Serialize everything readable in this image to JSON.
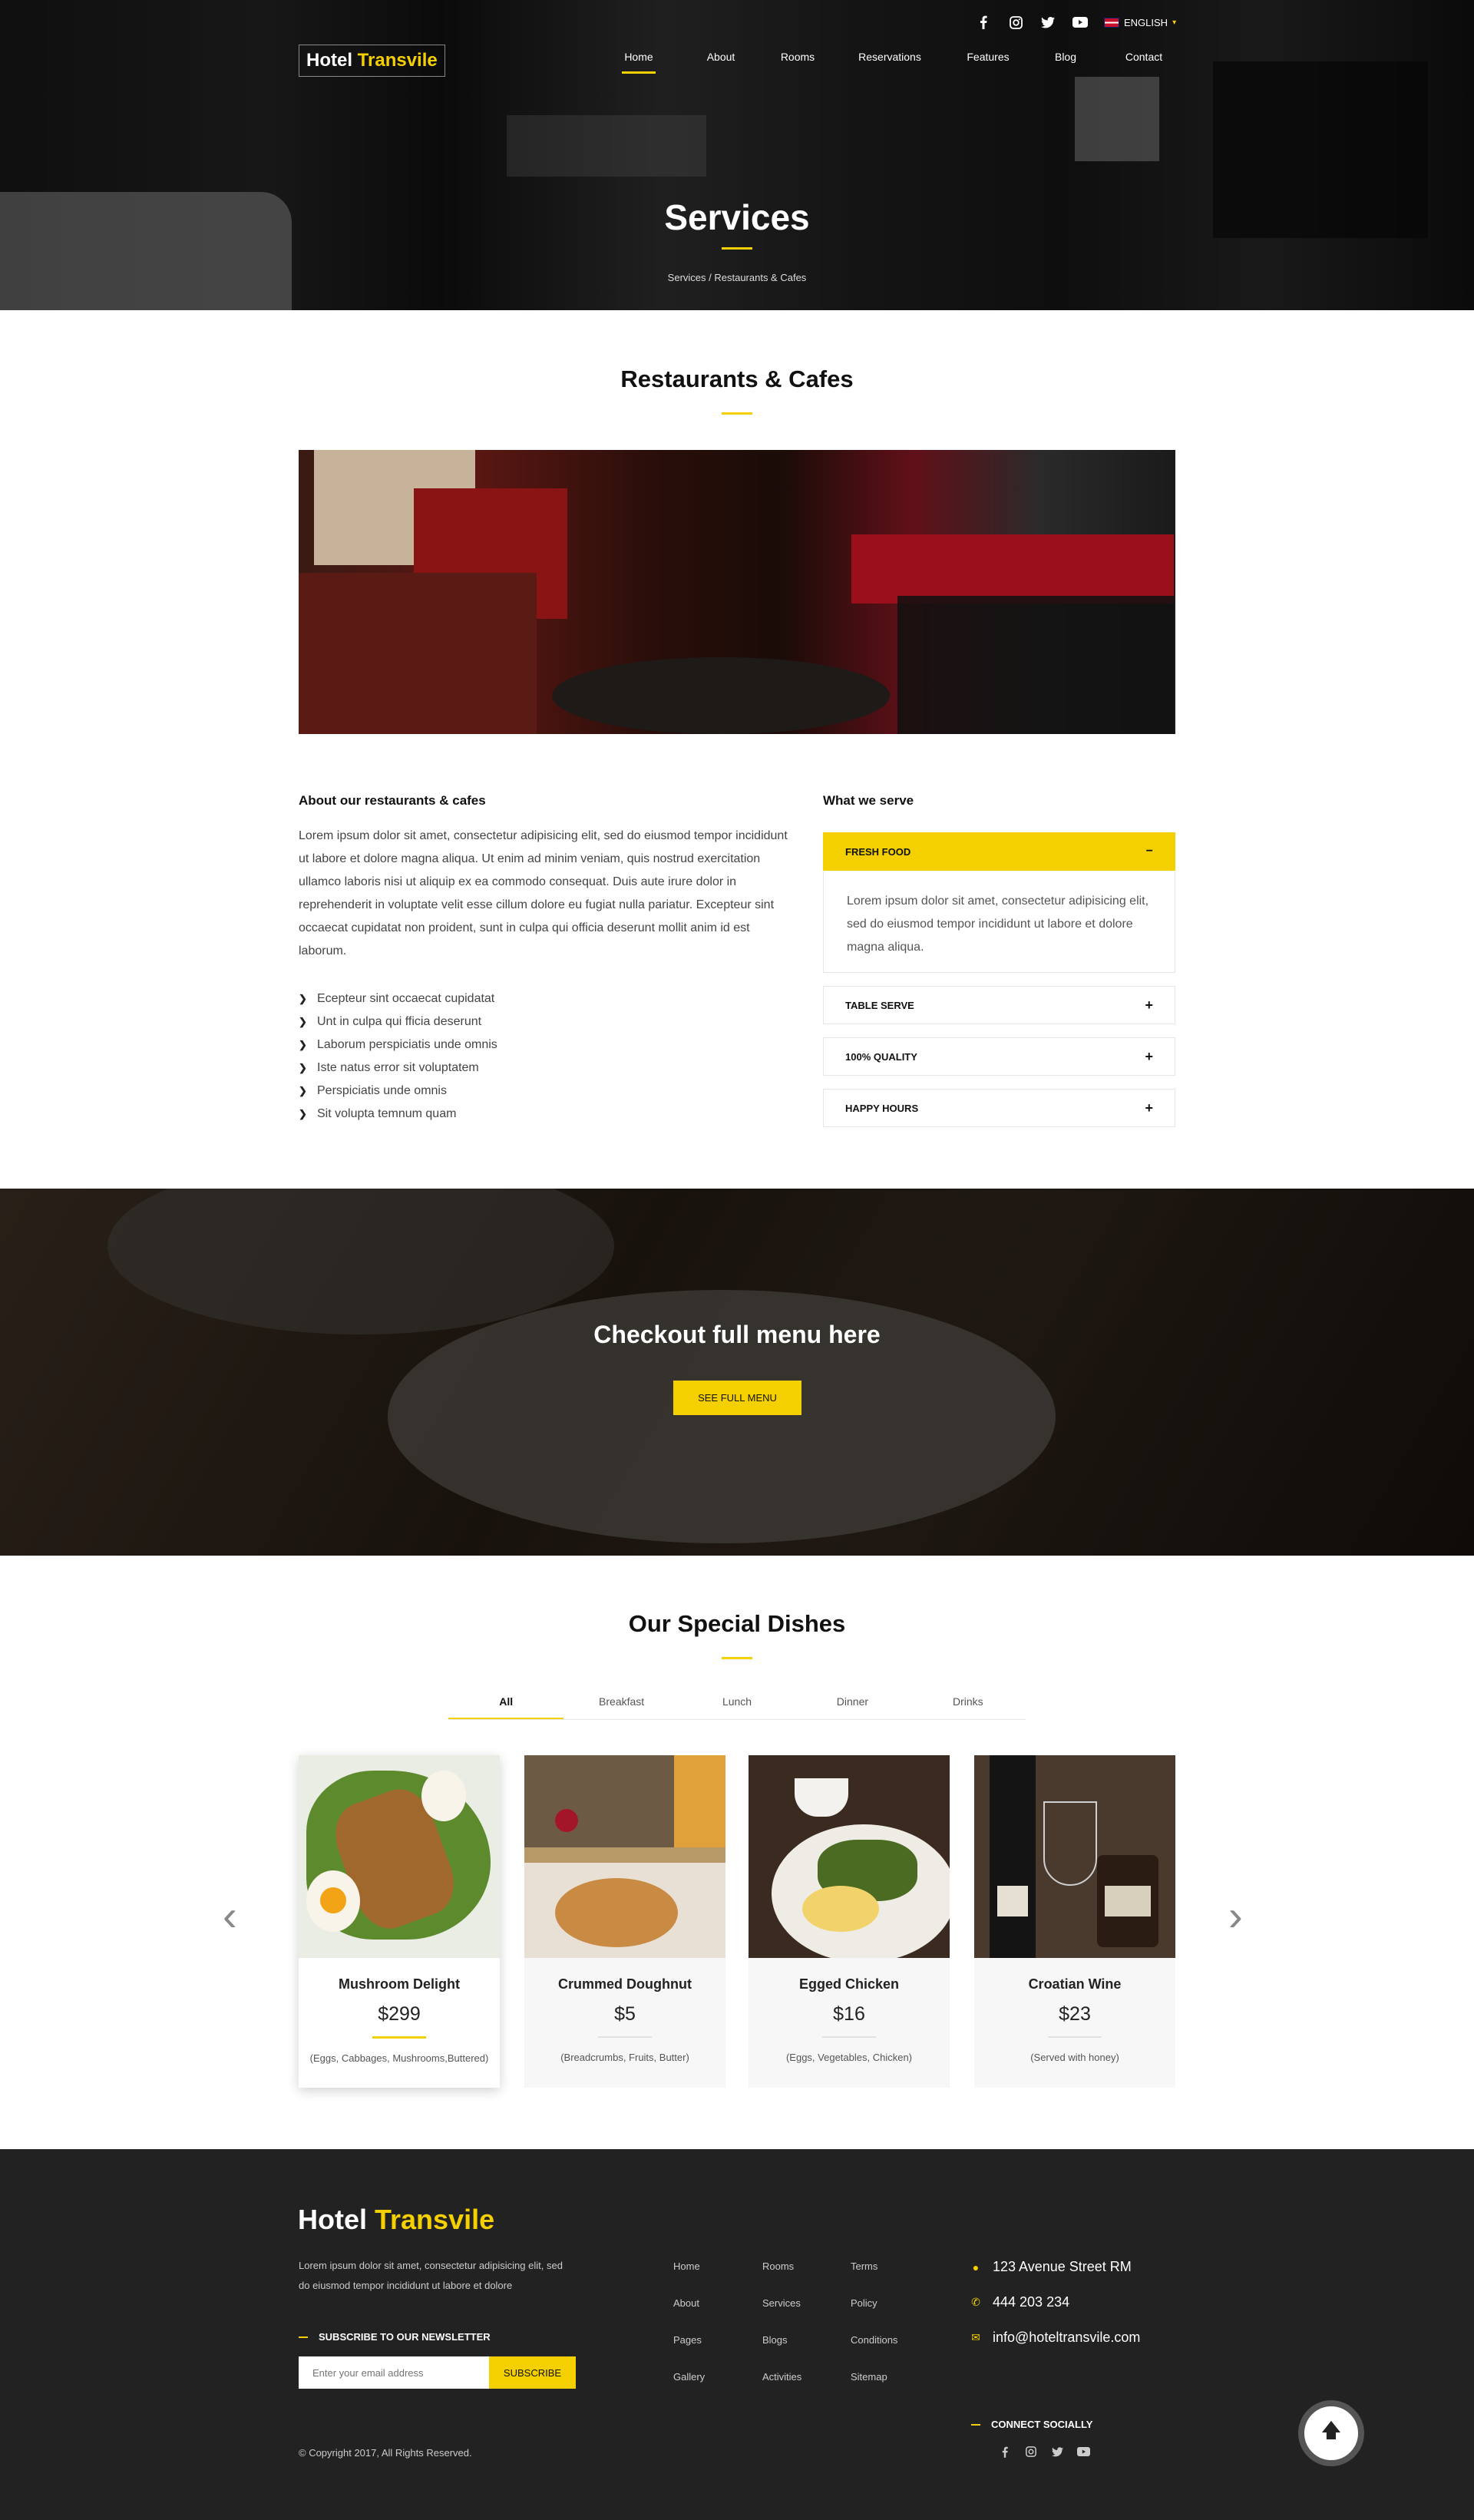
{
  "header": {
    "logo_part1": "Hotel",
    "logo_part2": "Transvile",
    "language": "ENGLISH",
    "social_icons": [
      "facebook-icon",
      "instagram-icon",
      "twitter-icon",
      "youtube-icon"
    ],
    "nav": [
      "Home",
      "About",
      "Rooms",
      "Reservations",
      "Features",
      "Blog",
      "Contact"
    ],
    "active_nav": "Home"
  },
  "hero": {
    "title": "Services",
    "breadcrumb": "Services / Restaurants & Cafes"
  },
  "restaurants": {
    "title": "Restaurants & Cafes",
    "about_heading": "About our restaurants & cafes",
    "about_text": "Lorem ipsum dolor sit amet, consectetur adipisicing elit, sed do eiusmod tempor incididunt ut labore et dolore magna aliqua. Ut enim ad minim veniam, quis nostrud exercitation ullamco laboris nisi ut aliquip ex ea commodo consequat. Duis aute irure dolor in reprehenderit in voluptate velit esse cillum dolore eu fugiat nulla pariatur. Excepteur sint occaecat cupidatat non proident, sunt in culpa qui officia deserunt mollit anim id est laborum.",
    "bullets": [
      "Ecepteur sint occaecat cupidatat",
      "Unt in culpa qui fficia deserunt",
      "Laborum perspiciatis unde omnis",
      "Iste natus error sit voluptatem",
      "Perspiciatis unde omnis",
      "Sit volupta temnum quam"
    ],
    "serve_heading": "What we serve",
    "accordion": [
      {
        "label": "FRESH FOOD",
        "symbol": "−",
        "open": true,
        "body": "Lorem ipsum dolor sit amet, consectetur adipisicing elit, sed do eiusmod tempor incididunt ut labore et dolore magna aliqua."
      },
      {
        "label": "TABLE SERVE",
        "symbol": "+",
        "open": false
      },
      {
        "label": "100% QUALITY",
        "symbol": "+",
        "open": false
      },
      {
        "label": "HAPPY HOURS",
        "symbol": "+",
        "open": false
      }
    ]
  },
  "menu_banner": {
    "title": "Checkout full menu here",
    "button": "SEE FULL MENU"
  },
  "dishes": {
    "title": "Our Special Dishes",
    "tabs": [
      "All",
      "Breakfast",
      "Lunch",
      "Dinner",
      "Drinks"
    ],
    "active_tab": "All",
    "items": [
      {
        "name": "Mushroom Delight",
        "price": "$299",
        "desc": "(Eggs, Cabbages, Mushrooms,Buttered)"
      },
      {
        "name": "Crummed Doughnut",
        "price": "$5",
        "desc": "(Breadcrumbs, Fruits, Butter)"
      },
      {
        "name": "Egged Chicken",
        "price": "$16",
        "desc": "(Eggs, Vegetables, Chicken)"
      },
      {
        "name": "Croatian Wine",
        "price": "$23",
        "desc": "(Served with honey)"
      }
    ]
  },
  "footer": {
    "logo_part1": "Hotel",
    "logo_part2": "Transvile",
    "text": "Lorem ipsum dolor sit amet, consectetur adipisicing elit, sed do eiusmod tempor incididunt ut labore et dolore",
    "newsletter_heading": "SUBSCRIBE TO OUR NEWSLETTER",
    "email_placeholder": "Enter your email address",
    "subscribe": "SUBSCRIBE",
    "col1": [
      "Home",
      "About",
      "Pages",
      "Gallery"
    ],
    "col2": [
      "Rooms",
      "Services",
      "Blogs",
      "Activities"
    ],
    "col3": [
      "Terms",
      "Policy",
      "Conditions",
      "Sitemap"
    ],
    "address": "123 Avenue Street RM",
    "phone": "444 203 234",
    "email": "info@hoteltransvile.com",
    "social_heading": "CONNECT SOCIALLY",
    "copyright": "© Copyright 2017, All Rights Reserved."
  },
  "colors": {
    "accent": "#f5d000",
    "footer_bg": "#222222"
  }
}
